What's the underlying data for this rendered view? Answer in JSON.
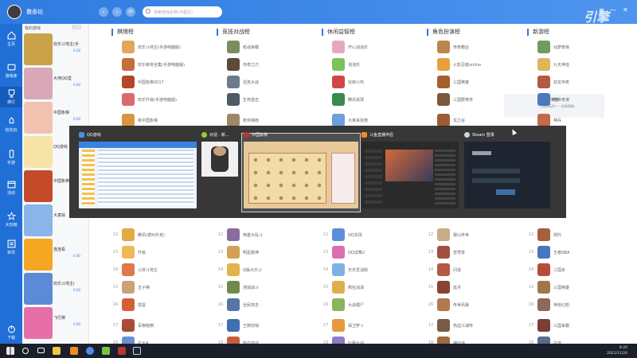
{
  "header": {
    "username": "撒香钻",
    "back_icon": "chevron-left-icon",
    "forward_icon": "chevron-right-icon",
    "refresh_icon": "refresh-icon",
    "search_placeholder": "搜索游戏名称(不超过)",
    "menu_icon": "menu-icon",
    "minimize_icon": "minimize-icon",
    "close_icon": "close-icon",
    "brand": "引擎"
  },
  "sidebar": {
    "items": [
      {
        "label": "主页",
        "icon": "home-icon"
      },
      {
        "label": "游戏库",
        "icon": "game-library-icon"
      },
      {
        "label": "排行",
        "icon": "trophy-icon"
      },
      {
        "label": "抢先玩",
        "icon": "rocket-icon"
      },
      {
        "label": "手游",
        "icon": "phone-icon"
      },
      {
        "label": "活动",
        "icon": "calendar-icon"
      },
      {
        "label": "大玩咖",
        "icon": "star-icon"
      },
      {
        "label": "资讯",
        "icon": "news-icon"
      }
    ],
    "footer": {
      "label": "下载",
      "icon": "power-icon"
    }
  },
  "recent": {
    "header": "我的游戏",
    "tag": "已经",
    "items": [
      {
        "name": "欢乐斗地主(手",
        "sub": "0.28",
        "color": "#c9a24a"
      },
      {
        "name": "大地QQ堂",
        "sub": "0.00",
        "color": "#d8a7b8"
      },
      {
        "name": "中国象棋",
        "sub": "0.00",
        "color": "#f1c2b0"
      },
      {
        "name": "QQ游戏",
        "sub": "",
        "color": "#f6e3a8"
      },
      {
        "name": "中国象棋",
        "sub": "",
        "color": "#c44b2a"
      },
      {
        "name": "大富翁",
        "sub": "",
        "color": "#8ab4ea"
      },
      {
        "name": "连连看",
        "sub": "0.00",
        "color": "#f5a623"
      },
      {
        "name": "欢乐斗地主(",
        "sub": "0.00",
        "color": "#5b8bd6"
      },
      {
        "name": "飞行棋",
        "sub": "0.00",
        "color": "#e76fa8"
      }
    ]
  },
  "columns": [
    {
      "title": "棋牌榜",
      "rows": [
        {
          "n": "",
          "label": "欢乐斗地主(手游电脑版)",
          "c": "#e4a65b"
        },
        {
          "n": "",
          "label": "欢乐麻将全集(手游电脑版)",
          "c": "#c86b3d"
        },
        {
          "n": "",
          "label": "中国象棋2017",
          "c": "#b34728"
        },
        {
          "n": "",
          "label": "欢乐升级(手游电脑版)",
          "c": "#d96b6b"
        },
        {
          "n": "",
          "label": "新中国象棋",
          "c": "#d8953c"
        },
        {
          "n": "12",
          "label": "腾讯(德州扑克)",
          "c": "#e3a944"
        },
        {
          "n": "13",
          "label": "升级",
          "c": "#f0b855"
        },
        {
          "n": "14",
          "label": "火拼斗地主",
          "c": "#e07848"
        },
        {
          "n": "15",
          "label": "五子棋",
          "c": "#c9a27a"
        },
        {
          "n": "16",
          "label": "掼蛋",
          "c": "#d35f3a"
        },
        {
          "n": "17",
          "label": "军棋暗棋",
          "c": "#a84c3a"
        },
        {
          "n": "18",
          "label": "打大A",
          "c": "#6a8fd4"
        }
      ]
    },
    {
      "title": "竞技对战榜",
      "rows": [
        {
          "n": "",
          "label": "枪战争霸",
          "c": "#7d8c5e"
        },
        {
          "n": "",
          "label": "传奇之刃",
          "c": "#5d4a3a"
        },
        {
          "n": "",
          "label": "坦克大战",
          "c": "#6c7a8a"
        },
        {
          "n": "",
          "label": "生死狙击",
          "c": "#4e5a66"
        },
        {
          "n": "",
          "label": "枪林弹雨",
          "c": "#a0876a"
        },
        {
          "n": "12",
          "label": "英雄大乱斗",
          "c": "#8a6d9e"
        },
        {
          "n": "13",
          "label": "明星跑神",
          "c": "#d4a053"
        },
        {
          "n": "14",
          "label": "Q版大乐斗",
          "c": "#e6b04a"
        },
        {
          "n": "15",
          "label": "地城战斗",
          "c": "#6f8a4a"
        },
        {
          "n": "16",
          "label": "全民突击",
          "c": "#5774a4"
        },
        {
          "n": "17",
          "label": "王牌前哨",
          "c": "#3f6fb1"
        },
        {
          "n": "18",
          "label": "热血激战",
          "c": "#c45e3a"
        }
      ]
    },
    {
      "title": "休闲益智榜",
      "rows": [
        {
          "n": "",
          "label": "开心消消乐",
          "c": "#e7a7c3"
        },
        {
          "n": "",
          "label": "泡泡乐",
          "c": "#7ec25c"
        },
        {
          "n": "",
          "label": "玩转小鸡",
          "c": "#d24545"
        },
        {
          "n": "",
          "label": "腾讯桌球",
          "c": "#3a8a4a"
        },
        {
          "n": "",
          "label": "大家来找茬",
          "c": "#6d9ee0"
        },
        {
          "n": "12",
          "label": "QQ龙珠",
          "c": "#5d8fd8"
        },
        {
          "n": "13",
          "label": "QQ炫舞2",
          "c": "#d86fb2"
        },
        {
          "n": "14",
          "label": "天天爱消除",
          "c": "#7db1e4"
        },
        {
          "n": "15",
          "label": "疯狂消消",
          "c": "#e0b04e"
        },
        {
          "n": "16",
          "label": "大战僵尸",
          "c": "#8bb45c"
        },
        {
          "n": "17",
          "label": "保卫萝卜",
          "c": "#e59a3d"
        },
        {
          "n": "18",
          "label": "比赛大战",
          "c": "#8f7ac8"
        }
      ]
    },
    {
      "title": "角色扮演榜",
      "rows": [
        {
          "n": "",
          "label": "传奇霸业",
          "c": "#b9874c"
        },
        {
          "n": "",
          "label": "火影忍者online",
          "c": "#e6a03e"
        },
        {
          "n": "",
          "label": "三国英雄",
          "c": "#a65e2e"
        },
        {
          "n": "",
          "label": "三国群英传",
          "c": "#7a5a3a"
        },
        {
          "n": "",
          "label": "龙之谷",
          "c": "#9b5d34"
        },
        {
          "n": "12",
          "label": "银山传世",
          "c": "#c8ad88"
        },
        {
          "n": "13",
          "label": "苍穹变",
          "c": "#a34f3d"
        },
        {
          "n": "14",
          "label": "问道",
          "c": "#b25a44"
        },
        {
          "n": "15",
          "label": "蓝月",
          "c": "#8a4232"
        },
        {
          "n": "16",
          "label": "传世风暴",
          "c": "#b07a4e"
        },
        {
          "n": "17",
          "label": "热血江湖传",
          "c": "#7a5a48"
        },
        {
          "n": "18",
          "label": "神仙道",
          "c": "#9e6a3e"
        }
      ]
    },
    {
      "title": "新游榜",
      "rows": [
        {
          "n": "",
          "label": "仙梦奇缘",
          "c": "#6d9c5e"
        },
        {
          "n": "",
          "label": "九天神途",
          "c": "#e0b65a"
        },
        {
          "n": "",
          "label": "双龙传奇",
          "c": "#b05a42"
        },
        {
          "n": "",
          "label": "绝世奇谋",
          "c": "#4c7ab8"
        },
        {
          "n": "",
          "label": "神兵",
          "c": "#c26a4a"
        },
        {
          "n": "12",
          "label": "契约",
          "c": "#a65f3c"
        },
        {
          "n": "13",
          "label": "王者NBA",
          "c": "#4a76c0"
        },
        {
          "n": "14",
          "label": "三国杀",
          "c": "#b84a3a"
        },
        {
          "n": "15",
          "label": "三国英雄",
          "c": "#9e7a42"
        },
        {
          "n": "16",
          "label": "神途幻想",
          "c": "#8a6a58"
        },
        {
          "n": "17",
          "label": "三国争霸",
          "c": "#7a3e32"
        },
        {
          "n": "18",
          "label": "征途",
          "c": "#5a6a8a"
        }
      ]
    }
  ],
  "hover_card": {
    "title": "三国群英传",
    "desc": "三国群英传一一经典策略..."
  },
  "switcher": {
    "items": [
      {
        "title": "QQ游戏",
        "icon_color": "#4a90e2"
      },
      {
        "title": "对话 - 新...",
        "icon_color": "#9acd32"
      },
      {
        "title": "中国象棋",
        "icon_color": "#b23a2a"
      },
      {
        "title": "斗鱼直播伴侣",
        "icon_color": "#f08a24"
      },
      {
        "title": "Steam 登录",
        "icon_color": "#1b2838"
      }
    ]
  },
  "taskbar": {
    "time": "8:20",
    "date": "2021/11/24",
    "apps": [
      "start-icon",
      "search-icon",
      "taskview-icon",
      "explorer-icon",
      "qqgame-icon",
      "chess-icon",
      "douyu-icon",
      "steam-icon"
    ]
  },
  "colors": {
    "accent": "#2f7be0",
    "sidebar": "#1f6fd6"
  }
}
